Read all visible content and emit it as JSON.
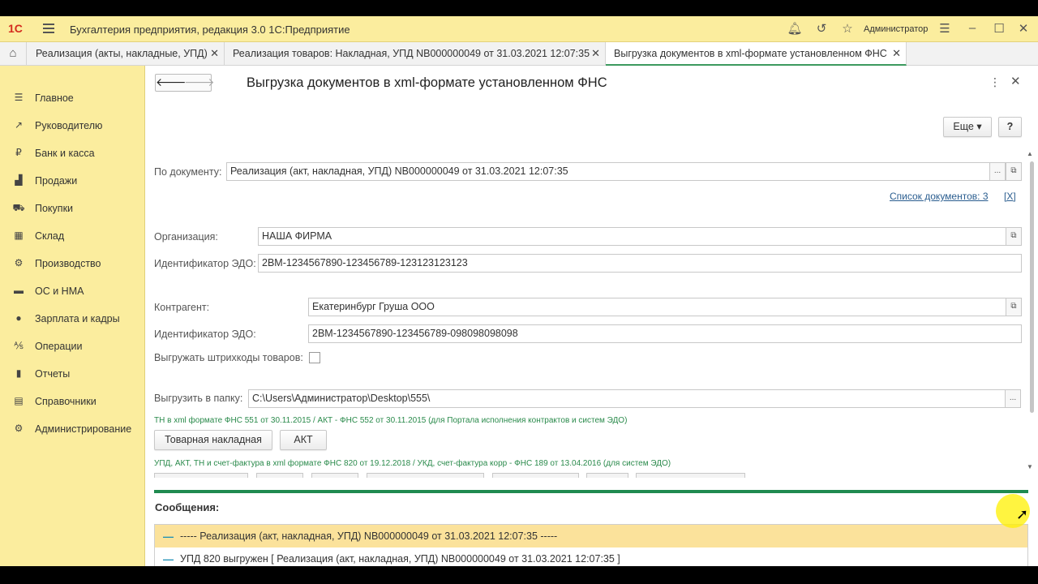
{
  "app": {
    "logo": "1С",
    "title": "Бухгалтерия предприятия, редакция 3.0 1С:Предприятие",
    "user": "Администратор"
  },
  "tabs": [
    {
      "label": "Реализация (акты, накладные, УПД)"
    },
    {
      "label": "Реализация товаров: Накладная, УПД NB000000049 от 31.03.2021 12:07:35"
    },
    {
      "label": "Выгрузка документов в xml-формате установленном ФНС"
    }
  ],
  "sidebar": {
    "items": [
      {
        "label": "Главное",
        "icon": "menu-icon"
      },
      {
        "label": "Руководителю",
        "icon": "trend-icon"
      },
      {
        "label": "Банк и касса",
        "icon": "ruble-icon"
      },
      {
        "label": "Продажи",
        "icon": "bag-icon"
      },
      {
        "label": "Покупки",
        "icon": "cart-icon"
      },
      {
        "label": "Склад",
        "icon": "warehouse-icon"
      },
      {
        "label": "Производство",
        "icon": "factory-icon"
      },
      {
        "label": "ОС и НМА",
        "icon": "truck-icon"
      },
      {
        "label": "Зарплата и кадры",
        "icon": "person-icon"
      },
      {
        "label": "Операции",
        "icon": "operations-icon"
      },
      {
        "label": "Отчеты",
        "icon": "chart-icon"
      },
      {
        "label": "Справочники",
        "icon": "book-icon"
      },
      {
        "label": "Администрирование",
        "icon": "gear-icon"
      }
    ]
  },
  "form": {
    "title": "Выгрузка документов в xml-формате установленном ФНС",
    "more_label": "Еще",
    "help_label": "?",
    "doc_label": "По документу:",
    "doc_value": "Реализация (акт, накладная, УПД) NB000000049 от 31.03.2021 12:07:35",
    "doc_list_link": "Список документов: 3",
    "doc_list_clear": "[X]",
    "org_label": "Организация:",
    "org_value": "НАША ФИРМА",
    "org_edo_label": "Идентификатор ЭДО:",
    "org_edo_value": "2BM-1234567890-123456789-123123123123",
    "counterparty_label": "Контрагент:",
    "counterparty_value": "Екатеринбург Груша ООО",
    "cp_edo_label": "Идентификатор ЭДО:",
    "cp_edo_value": "2BM-1234567890-123456789-098098098098",
    "barcodes_label": "Выгружать штрихкоды товаров:",
    "folder_label": "Выгрузить в папку:",
    "folder_value": "C:\\Users\\Администратор\\Desktop\\555\\",
    "hint1": "ТН в xml формате ФНС 551 от 30.11.2015 / АКТ - ФНС 552 от 30.11.2015 (для Портала исполнения контрактов и систем ЭДО)",
    "btn_tn": "Товарная накладная",
    "btn_akt": "АКТ",
    "hint2": "УПД, АКТ, ТН и счет-фактура в xml формате ФНС 820 от 19.12.2018 / УКД, счет-фактура корр - ФНС 189 от 13.04.2016 (для систем ЭДО)"
  },
  "messages": {
    "title": "Сообщения:",
    "rows": [
      {
        "dash": "—",
        "text": "----- Реализация (акт, накладная, УПД) NB000000049 от 31.03.2021 12:07:35 -----"
      },
      {
        "dash": "—",
        "text": "УПД 820 выгружен [ Реализация (акт, накладная, УПД) NB000000049 от 31.03.2021 12:07:35 ]"
      }
    ]
  },
  "colors": {
    "accent_yellow": "#fbed9e",
    "accent_green": "#1f8a50",
    "selected_row": "#fbe29b"
  }
}
